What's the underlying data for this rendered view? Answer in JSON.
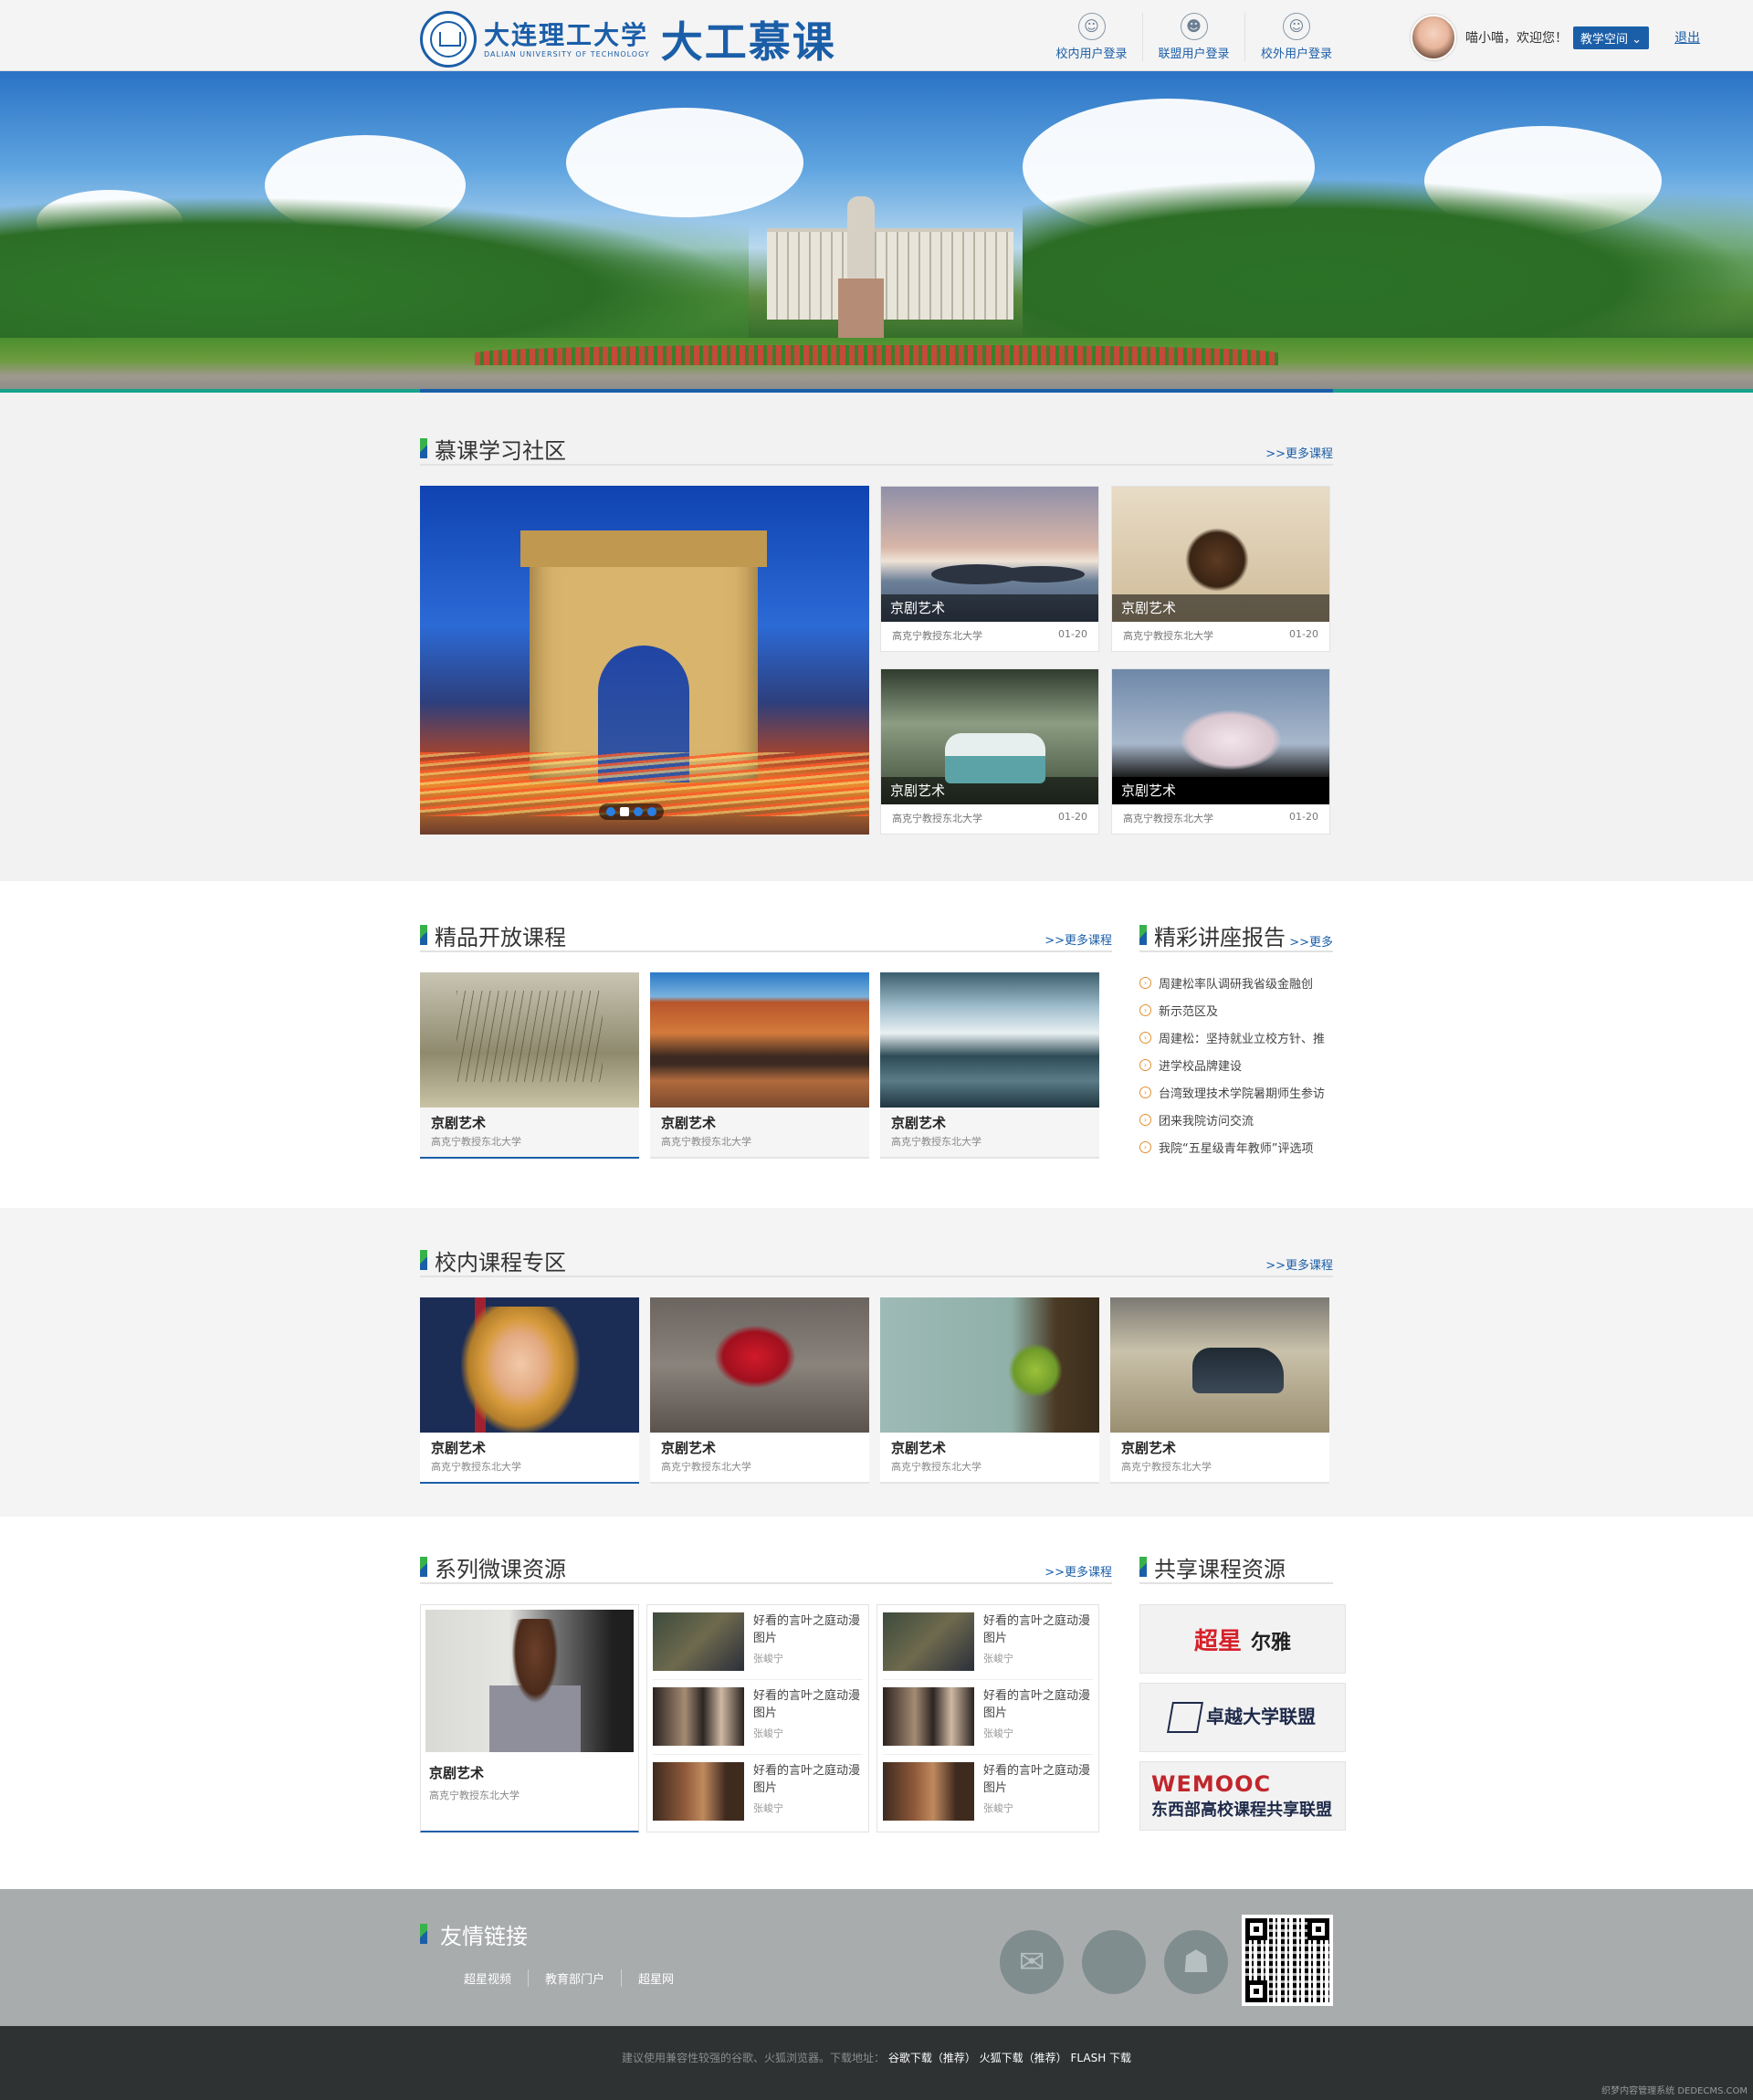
{
  "header": {
    "logo_cn": "大连理工大学",
    "logo_en": "DALIAN UNIVERSITY OF TECHNOLOGY",
    "site_name": "大工慕课",
    "logins": [
      {
        "label": "校内用户登录",
        "icon": "user-hat-icon"
      },
      {
        "label": "联盟用户登录",
        "icon": "user-group-icon"
      },
      {
        "label": "校外用户登录",
        "icon": "users-icon"
      }
    ],
    "greeting": "喵小喵，欢迎您！",
    "space_button": "教学空间",
    "logout": "退出"
  },
  "community": {
    "title": "慕课学习社区",
    "more": ">>更多课程",
    "cards": [
      {
        "caption": "京剧艺术",
        "author": "高克宁教授东北大学",
        "date": "01-20"
      },
      {
        "caption": "京剧艺术",
        "author": "高克宁教授东北大学",
        "date": "01-20"
      },
      {
        "caption": "京剧艺术",
        "author": "高克宁教授东北大学",
        "date": "01-20"
      },
      {
        "caption": "京剧艺术",
        "author": "高克宁教授东北大学",
        "date": "01-20"
      }
    ]
  },
  "open_courses": {
    "title": "精品开放课程",
    "more": ">>更多课程",
    "cards": [
      {
        "title": "京剧艺术",
        "author": "高克宁教授东北大学"
      },
      {
        "title": "京剧艺术",
        "author": "高克宁教授东北大学"
      },
      {
        "title": "京剧艺术",
        "author": "高克宁教授东北大学"
      }
    ]
  },
  "lectures": {
    "title": "精彩讲座报告",
    "more": ">>更多",
    "items": [
      "周建松率队调研我省级金融创",
      "新示范区及",
      "周建松：坚持就业立校方针、推",
      "进学校品牌建设",
      "台湾致理技术学院暑期师生参访",
      "团来我院访问交流",
      "我院“五星级青年教师”评选项"
    ]
  },
  "campus": {
    "title": "校内课程专区",
    "more": ">>更多课程",
    "cards": [
      {
        "title": "京剧艺术",
        "author": "高克宁教授东北大学"
      },
      {
        "title": "京剧艺术",
        "author": "高克宁教授东北大学"
      },
      {
        "title": "京剧艺术",
        "author": "高克宁教授东北大学"
      },
      {
        "title": "京剧艺术",
        "author": "高克宁教授东北大学"
      }
    ]
  },
  "micro": {
    "title": "系列微课资源",
    "more": ">>更多课程",
    "featured": {
      "title": "京剧艺术",
      "author": "高克宁教授东北大学"
    },
    "items": [
      {
        "title": "好看的言叶之庭动漫图片",
        "author": "张峻宁"
      },
      {
        "title": "好看的言叶之庭动漫图片",
        "author": "张峻宁"
      },
      {
        "title": "好看的言叶之庭动漫图片",
        "author": "张峻宁"
      },
      {
        "title": "好看的言叶之庭动漫图片",
        "author": "张峻宁"
      },
      {
        "title": "好看的言叶之庭动漫图片",
        "author": "张峻宁"
      },
      {
        "title": "好看的言叶之庭动漫图片",
        "author": "张峻宁"
      }
    ]
  },
  "shared": {
    "title": "共享课程资源",
    "partners": {
      "p1_a": "超星",
      "p1_b": "尔雅",
      "p2": "卓越大学联盟",
      "p3_a": "WEMOOC",
      "p3_b": "东西部高校课程共享联盟"
    }
  },
  "footer": {
    "title": "友情链接",
    "links": [
      "超星视频",
      "教育部门户",
      "超星网"
    ],
    "apps": [
      "chat-icon",
      "apple-icon",
      "android-icon"
    ],
    "notice": "建议使用兼容性较强的谷歌、火狐浏览器。下载地址：",
    "dl1": "谷歌下载（推荐）",
    "dl2": "火狐下载（推荐）",
    "dl3": "FLASH 下载",
    "watermark": "织梦内容管理系统 DEDECMS.COM"
  },
  "colors": {
    "brand": "#1b5ea8",
    "accent": "#38b24a",
    "footer": "#a9acad",
    "bottom": "#2f3233"
  }
}
